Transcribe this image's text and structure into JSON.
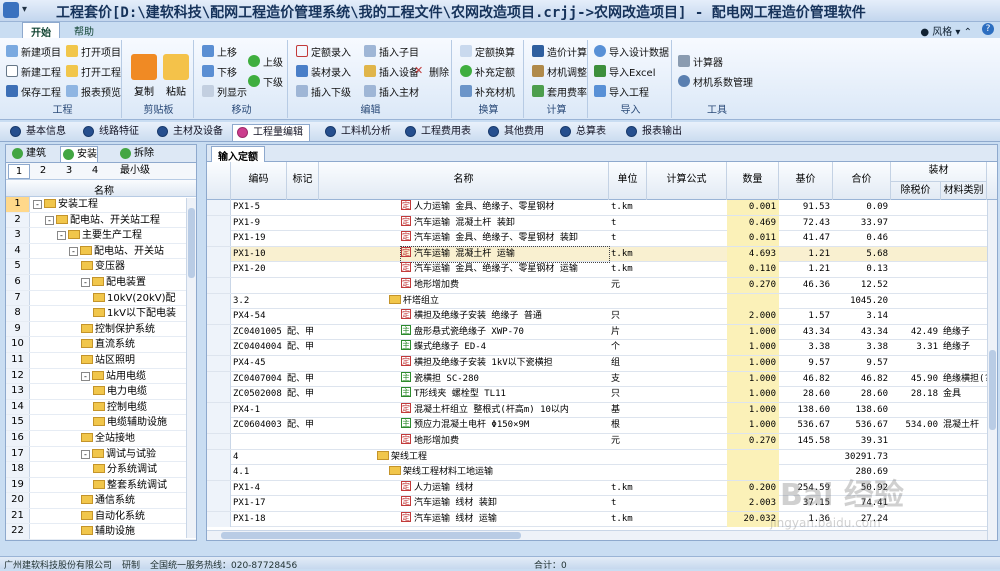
{
  "window": {
    "title": "工程套价[D:\\建软科技\\配网工程造价管理系统\\我的工程文件\\农网改造项目.crjj->农网改造项目] - 配电网工程造价管理软件"
  },
  "menu": {
    "tabs": [
      "开始",
      "帮助"
    ],
    "style_label": "风格",
    "help": "?"
  },
  "ribbon": {
    "groups": {
      "project": {
        "label": "工程",
        "items": [
          "新建项目",
          "打开项目",
          "新建工程",
          "打开工程",
          "保存工程",
          "报表预览"
        ]
      },
      "clipboard": {
        "label": "剪贴板",
        "copy": "复制",
        "paste": "粘贴"
      },
      "move": {
        "label": "移动",
        "items": [
          "上移",
          "下移",
          "列显示",
          "上级",
          "下级"
        ]
      },
      "edit": {
        "label": "编辑",
        "items": [
          "定额录入",
          "插入子目",
          "装材录入",
          "插入设备",
          "删除",
          "插入下级",
          "插入主材"
        ]
      },
      "convert": {
        "label": "换算",
        "items": [
          "定额换算",
          "补充定额",
          "补充材机"
        ]
      },
      "calc": {
        "label": "计算",
        "items": [
          "造价计算",
          "材机调整",
          "套用费率"
        ]
      },
      "import": {
        "label": "导入",
        "items": [
          "导入设计数据",
          "导入Excel",
          "导入工程"
        ]
      },
      "tools": {
        "label": "工具",
        "items": [
          "计算器",
          "材机系数管理"
        ]
      }
    }
  },
  "navtabs": [
    "基本信息",
    "线路特征",
    "主材及设备",
    "工程量编辑",
    "工料机分析",
    "工程费用表",
    "其他费用",
    "总算表",
    "报表输出"
  ],
  "left": {
    "tabs": [
      "建筑",
      "安装",
      "拆除"
    ],
    "levels": [
      "1",
      "2",
      "3",
      "4",
      "最小级"
    ],
    "column": "名称",
    "rows": [
      {
        "n": "1",
        "label": "安装工程",
        "indent": 0,
        "pm": "-"
      },
      {
        "n": "2",
        "label": "配电站、开关站工程",
        "indent": 1,
        "pm": "-"
      },
      {
        "n": "3",
        "label": "主要生产工程",
        "indent": 2,
        "pm": "-"
      },
      {
        "n": "4",
        "label": "配电站、开关站",
        "indent": 3,
        "pm": "-"
      },
      {
        "n": "5",
        "label": "变压器",
        "indent": 4,
        "pm": ""
      },
      {
        "n": "6",
        "label": "配电装置",
        "indent": 4,
        "pm": "-"
      },
      {
        "n": "7",
        "label": "10kV(20kV)配",
        "indent": 5,
        "pm": ""
      },
      {
        "n": "8",
        "label": "1kV以下配电装",
        "indent": 5,
        "pm": ""
      },
      {
        "n": "9",
        "label": "控制保护系统",
        "indent": 4,
        "pm": ""
      },
      {
        "n": "10",
        "label": "直流系统",
        "indent": 4,
        "pm": ""
      },
      {
        "n": "11",
        "label": "站区照明",
        "indent": 4,
        "pm": ""
      },
      {
        "n": "12",
        "label": "站用电缆",
        "indent": 4,
        "pm": "-"
      },
      {
        "n": "13",
        "label": "电力电缆",
        "indent": 5,
        "pm": ""
      },
      {
        "n": "14",
        "label": "控制电缆",
        "indent": 5,
        "pm": ""
      },
      {
        "n": "15",
        "label": "电缆辅助设施",
        "indent": 5,
        "pm": ""
      },
      {
        "n": "16",
        "label": "全站接地",
        "indent": 4,
        "pm": ""
      },
      {
        "n": "17",
        "label": "调试与试验",
        "indent": 4,
        "pm": "-"
      },
      {
        "n": "18",
        "label": "分系统调试",
        "indent": 5,
        "pm": ""
      },
      {
        "n": "19",
        "label": "整套系统调试",
        "indent": 5,
        "pm": ""
      },
      {
        "n": "20",
        "label": "通信系统",
        "indent": 4,
        "pm": ""
      },
      {
        "n": "21",
        "label": "自动化系统",
        "indent": 4,
        "pm": ""
      },
      {
        "n": "22",
        "label": "辅助设施",
        "indent": 4,
        "pm": ""
      }
    ]
  },
  "right": {
    "tab": "输入定额",
    "columns": {
      "code": "编码",
      "mark": "标记",
      "name": "名称",
      "unit": "单位",
      "formula": "计算公式",
      "qty": "数量",
      "base": "基价",
      "total": "合价",
      "group": "装材",
      "pre_tax": "除税价",
      "mat": "材料类别"
    },
    "rows": [
      {
        "code": "PX1-5",
        "mark": "",
        "tag": "定",
        "ind": 2,
        "name": "人力运输 金具、绝缘子、零星钢材",
        "unit": "t.km",
        "qty": "0.001",
        "base": "91.53",
        "total": "0.09",
        "pre": "",
        "mat": ""
      },
      {
        "code": "PX1-9",
        "mark": "",
        "tag": "定",
        "ind": 2,
        "name": "汽车运输 混凝土杆 装卸",
        "unit": "t",
        "qty": "0.469",
        "base": "72.43",
        "total": "33.97",
        "pre": "",
        "mat": ""
      },
      {
        "code": "PX1-19",
        "mark": "",
        "tag": "定",
        "ind": 2,
        "name": "汽车运输 金具、绝缘子、零星钢材 装卸",
        "unit": "t",
        "qty": "0.011",
        "base": "41.47",
        "total": "0.46",
        "pre": "",
        "mat": ""
      },
      {
        "code": "PX1-10",
        "mark": "",
        "tag": "定",
        "ind": 2,
        "name": "汽车运输 混凝土杆 运输",
        "unit": "t.km",
        "qty": "4.693",
        "base": "1.21",
        "total": "5.68",
        "pre": "",
        "mat": "",
        "sel": true
      },
      {
        "code": "PX1-20",
        "mark": "",
        "tag": "定",
        "ind": 2,
        "name": "汽车运输 金具、绝缘子、零星钢材 运输",
        "unit": "t.km",
        "qty": "0.110",
        "base": "1.21",
        "total": "0.13",
        "pre": "",
        "mat": ""
      },
      {
        "code": "",
        "mark": "",
        "tag": "定",
        "ind": 2,
        "name": "地形增加费",
        "unit": "元",
        "qty": "0.270",
        "base": "46.36",
        "total": "12.52",
        "pre": "",
        "mat": ""
      },
      {
        "code": "3.2",
        "mark": "",
        "tag": "F",
        "ind": 1,
        "name": "杆塔组立",
        "unit": "",
        "qty": "",
        "base": "",
        "total": "1045.20",
        "pre": "",
        "mat": ""
      },
      {
        "code": "PX4-54",
        "mark": "",
        "tag": "定",
        "ind": 2,
        "name": "横担及绝缘子安装 绝缘子 普通",
        "unit": "只",
        "qty": "2.000",
        "base": "1.57",
        "total": "3.14",
        "pre": "",
        "mat": ""
      },
      {
        "code": "ZC0401005",
        "mark": "配、甲",
        "tag": "主",
        "ind": 2,
        "name": "盘形悬式瓷绝缘子 XWP-70",
        "unit": "片",
        "qty": "1.000",
        "base": "43.34",
        "total": "43.34",
        "pre": "42.49",
        "mat": "绝缘子"
      },
      {
        "code": "ZC0404004",
        "mark": "配、甲",
        "tag": "主",
        "ind": 2,
        "name": "蝶式绝缘子 ED-4",
        "unit": "个",
        "qty": "1.000",
        "base": "3.38",
        "total": "3.38",
        "pre": "3.31",
        "mat": "绝缘子"
      },
      {
        "code": "PX4-45",
        "mark": "",
        "tag": "定",
        "ind": 2,
        "name": "横担及绝缘子安装 1kV以下瓷横担",
        "unit": "组",
        "qty": "1.000",
        "base": "9.57",
        "total": "9.57",
        "pre": "",
        "mat": ""
      },
      {
        "code": "ZC0407004",
        "mark": "配、甲",
        "tag": "主",
        "ind": 2,
        "name": "瓷横担 SC-280",
        "unit": "支",
        "qty": "1.000",
        "base": "46.82",
        "total": "46.82",
        "pre": "45.90",
        "mat": "绝缘横担(?"
      },
      {
        "code": "ZC0502008",
        "mark": "配、甲",
        "tag": "主",
        "ind": 2,
        "name": "T形线夹 螺栓型 TL11",
        "unit": "只",
        "qty": "1.000",
        "base": "28.60",
        "total": "28.60",
        "pre": "28.18",
        "mat": "金具"
      },
      {
        "code": "PX4-1",
        "mark": "",
        "tag": "定",
        "ind": 2,
        "name": "混凝土杆组立 整根式(杆高m) 10以内",
        "unit": "基",
        "qty": "1.000",
        "base": "138.60",
        "total": "138.60",
        "pre": "",
        "mat": ""
      },
      {
        "code": "ZC0604003",
        "mark": "配、甲",
        "tag": "主",
        "ind": 2,
        "name": "预应力混凝土电杆 Φ150×9M",
        "unit": "根",
        "qty": "1.000",
        "base": "536.67",
        "total": "536.67",
        "pre": "534.00",
        "mat": "混凝土杆"
      },
      {
        "code": "",
        "mark": "",
        "tag": "定",
        "ind": 2,
        "name": "地形增加费",
        "unit": "元",
        "qty": "0.270",
        "base": "145.58",
        "total": "39.31",
        "pre": "",
        "mat": ""
      },
      {
        "code": "4",
        "mark": "",
        "tag": "F",
        "ind": 0,
        "name": "架线工程",
        "unit": "",
        "qty": "",
        "base": "",
        "total": "30291.73",
        "pre": "",
        "mat": ""
      },
      {
        "code": "4.1",
        "mark": "",
        "tag": "F",
        "ind": 1,
        "name": "架线工程材料工地运输",
        "unit": "",
        "qty": "",
        "base": "",
        "total": "280.69",
        "pre": "",
        "mat": ""
      },
      {
        "code": "PX1-4",
        "mark": "",
        "tag": "定",
        "ind": 2,
        "name": "人力运输 线材",
        "unit": "t.km",
        "qty": "0.200",
        "base": "254.59",
        "total": "50.92",
        "pre": "",
        "mat": ""
      },
      {
        "code": "PX1-17",
        "mark": "",
        "tag": "定",
        "ind": 2,
        "name": "汽车运输 线材 装卸",
        "unit": "t",
        "qty": "2.003",
        "base": "37.15",
        "total": "74.41",
        "pre": "",
        "mat": ""
      },
      {
        "code": "PX1-18",
        "mark": "",
        "tag": "定",
        "ind": 2,
        "name": "汽车运输 线材 运输",
        "unit": "t.km",
        "qty": "20.032",
        "base": "1.36",
        "total": "27.24",
        "pre": "",
        "mat": ""
      }
    ]
  },
  "status": {
    "company": "广州建软科技股份有限公司",
    "dept": "研制",
    "hotline": "全国统一服务热线：020-87728456",
    "total": "合计：0"
  },
  "watermark": {
    "main": "Bai 经验",
    "sub": "jingyan.baidu.com"
  }
}
